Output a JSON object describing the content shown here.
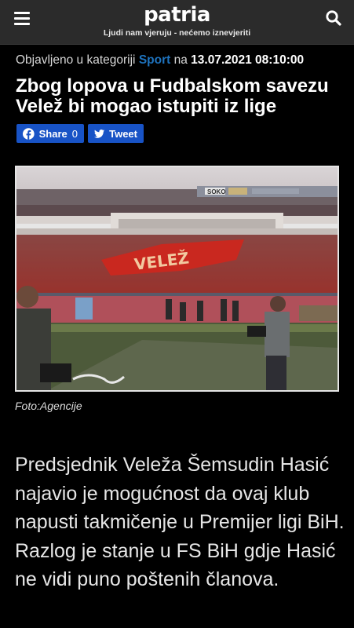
{
  "header": {
    "logo": "patria",
    "tagline": "Ljudi nam vjeruju - nećemo iznevjeriti"
  },
  "meta": {
    "prefix": "Objavljeno u kategoriji",
    "category": "Sport",
    "na": "na",
    "datetime": "13.07.2021 08:10:00"
  },
  "article": {
    "title": "Zbog lopova u Fudbalskom savezu Velež bi mogao istupiti iz lige",
    "image_text": {
      "banner": "VELEŽ",
      "ad1": "SOKO"
    },
    "caption": "Foto:Agencije",
    "body": "Predsjednik Veleža Šemsudin Hasić najavio je mogućnost da ovaj klub napusti takmičenje u Premijer ligi BiH. Razlog je stanje u FS BiH gdje Hasić ne vidi puno poštenih članova."
  },
  "share": {
    "facebook_label": "Share",
    "facebook_count": "0",
    "twitter_label": "Tweet"
  },
  "colors": {
    "header_bg": "#2b2b2b",
    "category": "#1e73be",
    "button_bg": "#1853c6",
    "banner_red": "#c9281f"
  }
}
